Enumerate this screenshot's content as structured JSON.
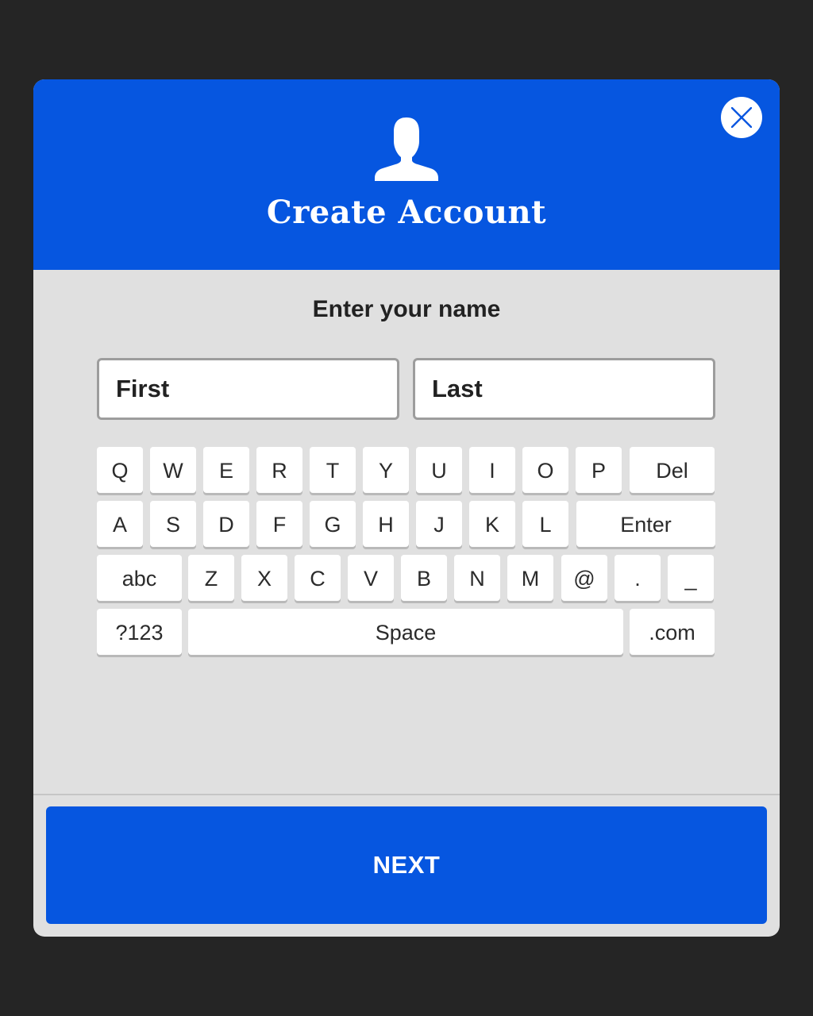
{
  "modal": {
    "title": "Create Account",
    "header_icon": "user-silhouette-icon",
    "close_icon": "close-icon"
  },
  "form": {
    "prompt": "Enter your name",
    "first_name": {
      "value": "",
      "placeholder": "First"
    },
    "last_name": {
      "value": "",
      "placeholder": "Last"
    }
  },
  "keyboard": {
    "row1": [
      "Q",
      "W",
      "E",
      "R",
      "T",
      "Y",
      "U",
      "I",
      "O",
      "P",
      "Del"
    ],
    "row2": [
      "A",
      "S",
      "D",
      "F",
      "G",
      "H",
      "J",
      "K",
      "L",
      "Enter"
    ],
    "row3": [
      "abc",
      "Z",
      "X",
      "C",
      "V",
      "B",
      "N",
      "M",
      "@",
      ".",
      "_"
    ],
    "row4": [
      "?123",
      "Space",
      ".com"
    ]
  },
  "footer": {
    "next_label": "NEXT"
  },
  "colors": {
    "accent": "#0656e0",
    "background": "#252525",
    "panel": "#e0e0e0"
  }
}
